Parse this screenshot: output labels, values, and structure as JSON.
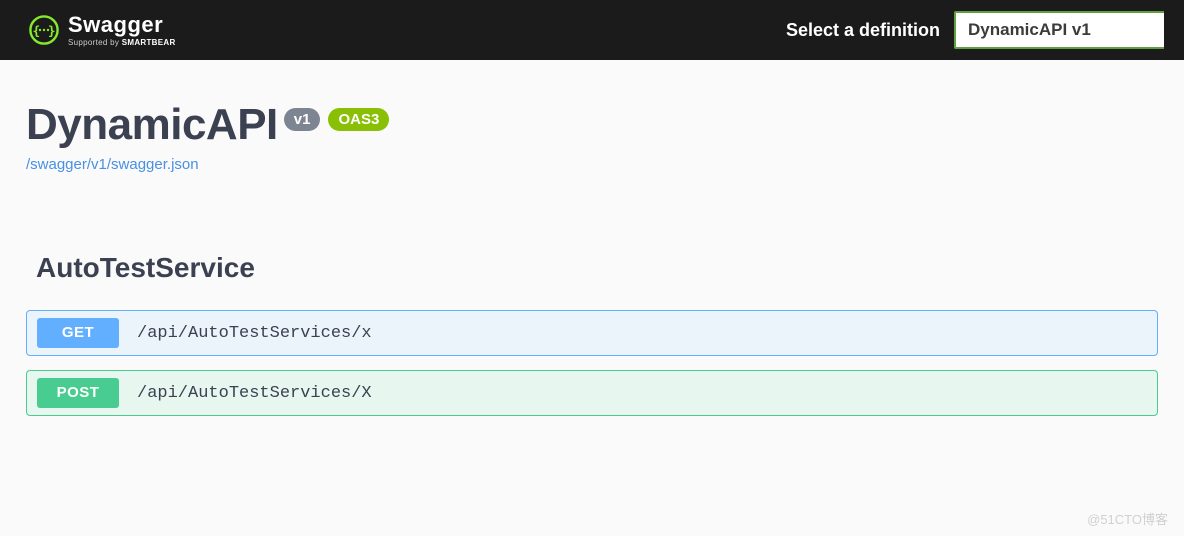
{
  "topbar": {
    "brand_title": "Swagger",
    "brand_subtext_prefix": "Supported by ",
    "brand_subtext_bold": "SMARTBEAR",
    "select_label": "Select a definition",
    "selected_definition": "DynamicAPI v1"
  },
  "info": {
    "title": "DynamicAPI",
    "version_badge": "v1",
    "oas_badge": "OAS3",
    "spec_url": "/swagger/v1/swagger.json"
  },
  "tag": {
    "name": "AutoTestService"
  },
  "operations": [
    {
      "method": "GET",
      "path": "/api/AutoTestServices/x",
      "style": "get"
    },
    {
      "method": "POST",
      "path": "/api/AutoTestServices/X",
      "style": "post"
    }
  ],
  "watermark": "@51CTO博客"
}
